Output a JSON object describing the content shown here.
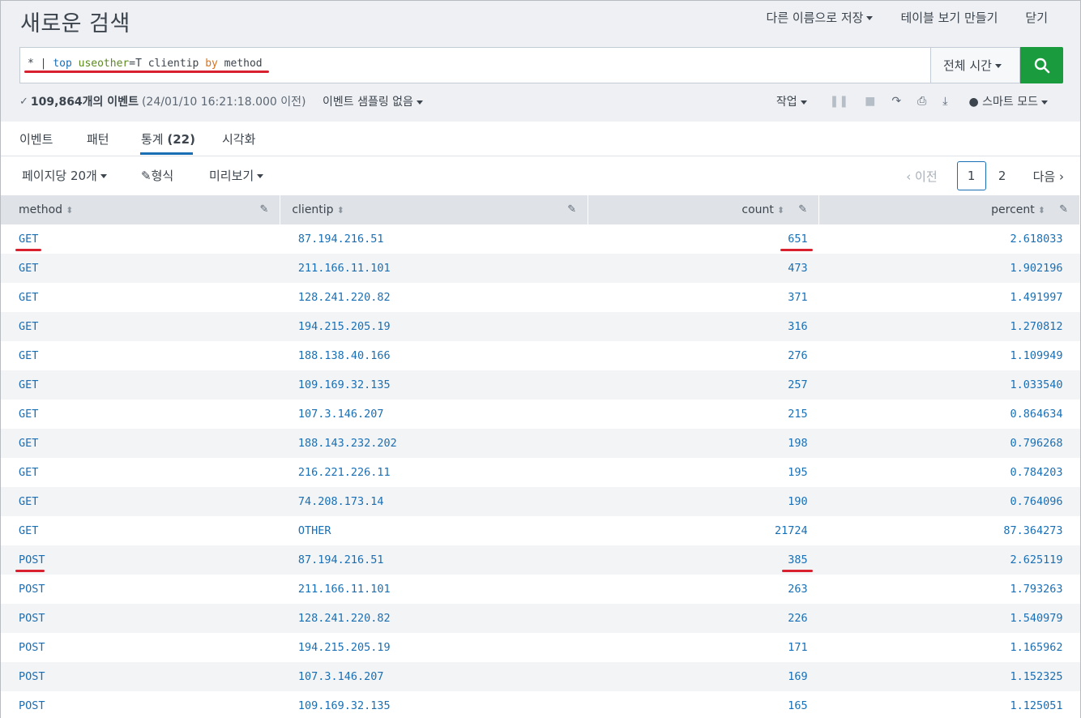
{
  "header": {
    "title": "새로운 검색",
    "save_as": "다른 이름으로 저장",
    "create_table": "테이블 보기 만들기",
    "close": "닫기"
  },
  "search": {
    "query_star": "*",
    "query_pipe": "|",
    "query_cmd": "top",
    "query_arg": "useother",
    "query_eq": "=T",
    "query_field": "clientip",
    "query_by": "by",
    "query_field2": "method",
    "time_range": "전체 시간"
  },
  "status": {
    "event_count": "109,864개의 이벤트",
    "since": "(24/01/10 16:21:18.000 이전)",
    "sampling": "이벤트 샘플링 없음",
    "job": "작업",
    "mode": "스마트 모드"
  },
  "tabs": {
    "events": "이벤트",
    "patterns": "패턴",
    "stats_label": "통계",
    "stats_count": "(22)",
    "viz": "시각화"
  },
  "options": {
    "per_page": "페이지당 20개",
    "format": "형식",
    "preview": "미리보기"
  },
  "pager": {
    "prev": "‹ 이전",
    "page1": "1",
    "page2": "2",
    "next": "다음 ›"
  },
  "table": {
    "columns": [
      "method",
      "clientip",
      "count",
      "percent"
    ],
    "rows": [
      {
        "method": "GET",
        "clientip": "87.194.216.51",
        "count": "651",
        "percent": "2.618033"
      },
      {
        "method": "GET",
        "clientip": "211.166.11.101",
        "count": "473",
        "percent": "1.902196"
      },
      {
        "method": "GET",
        "clientip": "128.241.220.82",
        "count": "371",
        "percent": "1.491997"
      },
      {
        "method": "GET",
        "clientip": "194.215.205.19",
        "count": "316",
        "percent": "1.270812"
      },
      {
        "method": "GET",
        "clientip": "188.138.40.166",
        "count": "276",
        "percent": "1.109949"
      },
      {
        "method": "GET",
        "clientip": "109.169.32.135",
        "count": "257",
        "percent": "1.033540"
      },
      {
        "method": "GET",
        "clientip": "107.3.146.207",
        "count": "215",
        "percent": "0.864634"
      },
      {
        "method": "GET",
        "clientip": "188.143.232.202",
        "count": "198",
        "percent": "0.796268"
      },
      {
        "method": "GET",
        "clientip": "216.221.226.11",
        "count": "195",
        "percent": "0.784203"
      },
      {
        "method": "GET",
        "clientip": "74.208.173.14",
        "count": "190",
        "percent": "0.764096"
      },
      {
        "method": "GET",
        "clientip": "OTHER",
        "count": "21724",
        "percent": "87.364273"
      },
      {
        "method": "POST",
        "clientip": "87.194.216.51",
        "count": "385",
        "percent": "2.625119"
      },
      {
        "method": "POST",
        "clientip": "211.166.11.101",
        "count": "263",
        "percent": "1.793263"
      },
      {
        "method": "POST",
        "clientip": "128.241.220.82",
        "count": "226",
        "percent": "1.540979"
      },
      {
        "method": "POST",
        "clientip": "194.215.205.19",
        "count": "171",
        "percent": "1.165962"
      },
      {
        "method": "POST",
        "clientip": "107.3.146.207",
        "count": "169",
        "percent": "1.152325"
      },
      {
        "method": "POST",
        "clientip": "109.169.32.135",
        "count": "165",
        "percent": "1.125051"
      }
    ]
  },
  "colors": {
    "accent": "#1a6fb4",
    "search_button": "#1a9c3e",
    "highlight_underline": "#d8202f"
  }
}
